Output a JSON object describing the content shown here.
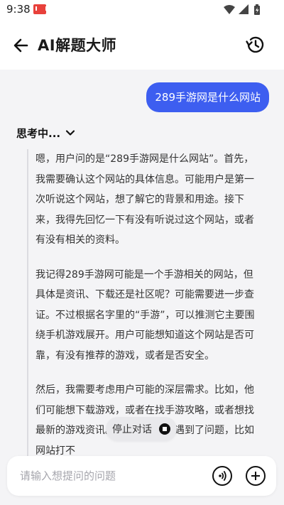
{
  "status_bar": {
    "time": "9:38",
    "icons": [
      "app-notification-icon",
      "wifi-icon",
      "signal-icon",
      "battery-icon"
    ]
  },
  "header": {
    "back_icon": "back-arrow-icon",
    "title": "AI解题大师",
    "history_icon": "history-icon"
  },
  "chat": {
    "user_message": "289手游网是什么网站",
    "thinking_label": "思考中...",
    "thinking_paragraphs": [
      "嗯，用户问的是“289手游网是什么网站”。首先，我需要确认这个网站的具体信息。可能用户是第一次听说这个网站，想了解它的背景和用途。接下来，我得先回忆一下有没有听说过这个网站，或者有没有相关的资料。",
      "我记得289手游网可能是一个手游相关的网站，但具体是资讯、下载还是社区呢？可能需要进一步查证。不过根据名字里的“手游”，可以推测它主要围绕手机游戏展开。用户可能想知道这个网站是否可靠，有没有推荐的游戏，或者是否安全。",
      "然后，我需要考虑用户可能的深层需求。比如，他们可能想下载游戏，或者在找手游攻略，或者想找最新的游戏资讯。也有可能他们遇到了问题，比如网站打不"
    ]
  },
  "stop_button": {
    "label": "停止对话"
  },
  "input": {
    "placeholder": "请输入想提问的问题",
    "value": ""
  },
  "colors": {
    "accent": "#3d5ef0",
    "app_icon": "#e8413b"
  }
}
